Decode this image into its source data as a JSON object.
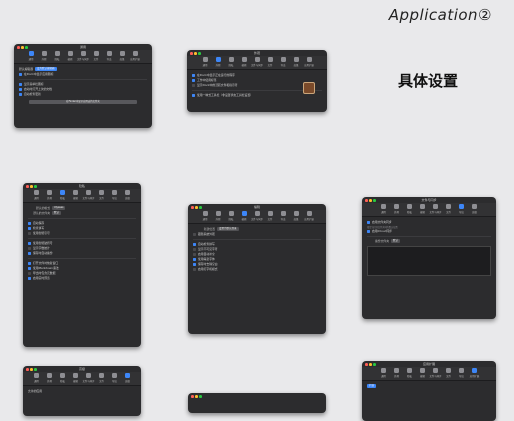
{
  "heading": "Application②",
  "subheading": "具体设置",
  "windows": {
    "w1": {
      "title": "通用",
      "toolbar": [
        "通用",
        "外观",
        "隐私",
        "编辑",
        "文件与同步",
        "文件",
        "导出",
        "高级",
        "应用扩展"
      ],
      "active_tab": 0,
      "rows": [
        "默认编辑器",
        "设为默认编辑器",
        "在Dock中显示应用图标",
        "显示菜单栏图标",
        "启动时打开上次的文档",
        "自动检查更新"
      ],
      "popup": "设为默认编辑器",
      "button": "在Finder中显示应用支持文件夹"
    },
    "w2": {
      "title": "外观",
      "toolbar": [
        "通用",
        "外观",
        "隐私",
        "编辑",
        "文件与同步",
        "文件",
        "导出",
        "高级",
        "应用扩展"
      ],
      "active_tab": 1,
      "rows": [
        "在Dock中显示正在运行的程序",
        "工作中使用标签",
        "显示Dock中的活跃文件和指示符",
        "使用一种式工具栏（非设置状态工具栏设置）"
      ]
    },
    "w3": {
      "title": "隐私",
      "toolbar": [
        "通用",
        "外观",
        "隐私",
        "编辑",
        "文件与同步",
        "文件",
        "导出",
        "高级",
        "应用扩展"
      ],
      "active_tab": 2,
      "label_a": "默认的格式",
      "label_b": "默认的文件夹",
      "popup_a": "Ulysses",
      "popup_b": "默认",
      "rows": [
        "自动保存",
        "检查拼写",
        "使用智能引号",
        "使用智能破折号",
        "显示字数统计",
        "保存时自动备份",
        "打开文件时恢复窗口",
        "使用Markdown语法",
        "导出时包含元数据",
        "启用实时预览"
      ]
    },
    "w4": {
      "title": "编辑",
      "toolbar": [
        "通用",
        "外观",
        "隐私",
        "编辑",
        "文件与同步",
        "文件",
        "导出",
        "高级",
        "应用扩展"
      ],
      "active_tab": 3,
      "label": "新建位置",
      "popup": "设置为默认目录",
      "rows": [
        "跟随系统外观",
        "自动检查拼写",
        "显示不可见字符",
        "启用自动补全",
        "使用等宽字体",
        "保存时去除空白",
        "启用打字机模式"
      ]
    },
    "w5": {
      "title": "文件与同步",
      "toolbar": [
        "通用",
        "外观",
        "隐私",
        "编辑",
        "文件与同步",
        "文件",
        "导出",
        "高级"
      ],
      "active_tab": 6,
      "section_a": "启用文件夹同步",
      "section_b": "启用iCloud同步",
      "label": "备份文件夹",
      "popup": "默认",
      "note": "指定当打开文件夹时的默认位置"
    },
    "w6": {
      "title": "应用扩展",
      "toolbar": [
        "通用",
        "外观",
        "隐私",
        "编辑",
        "文件与同步",
        "文件",
        "导出",
        "应用扩展"
      ],
      "active_tab": 7,
      "popup": "扩展"
    },
    "w7": {
      "title": "高级",
      "toolbar": [
        "通用",
        "外观",
        "隐私",
        "编辑",
        "文件与同步",
        "文件",
        "导出",
        "高级"
      ],
      "active_tab": 7,
      "rows": [
        "允许的应用"
      ]
    }
  }
}
